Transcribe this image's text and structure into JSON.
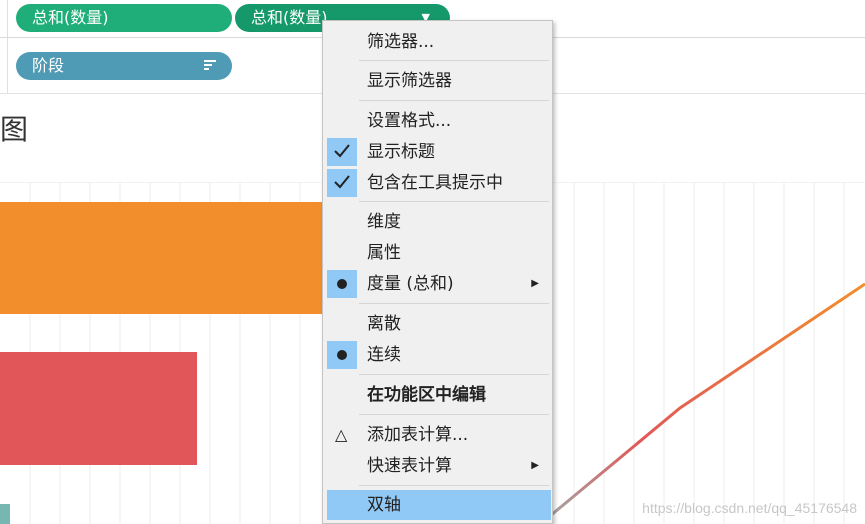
{
  "shelves": {
    "columns_pill_1": "总和(数量)",
    "columns_pill_2": "总和(数量)",
    "rows_pill": "阶段"
  },
  "sheet_title": "图",
  "context_menu": {
    "filter": "筛选器...",
    "show_filter": "显示筛选器",
    "format": "设置格式...",
    "show_header": "显示标题",
    "include_in_tooltip": "包含在工具提示中",
    "dimension": "维度",
    "attribute": "属性",
    "measure": "度量 (总和)",
    "discrete": "离散",
    "continuous": "连续",
    "edit_in_shelf": "在功能区中编辑",
    "add_table_calc": "添加表计算...",
    "quick_table_calc": "快速表计算",
    "dual_axis": "双轴"
  },
  "watermark": "https://blog.csdn.net/qq_45176548",
  "colors": {
    "pill_green": "#1fae7a",
    "pill_green_dark": "#15996a",
    "pill_blue": "#4f9ab5",
    "bar_orange": "#f28e2b",
    "bar_red": "#e15759",
    "bar_teal": "#76b7b2",
    "menu_highlight": "#90c8f6"
  },
  "icons": {
    "caret": "chevron-down-icon",
    "sort": "sort-descending-icon",
    "check": "checkmark-icon",
    "radio": "radio-dot-icon",
    "delta": "delta-icon",
    "submenu": "submenu-arrow-icon"
  }
}
